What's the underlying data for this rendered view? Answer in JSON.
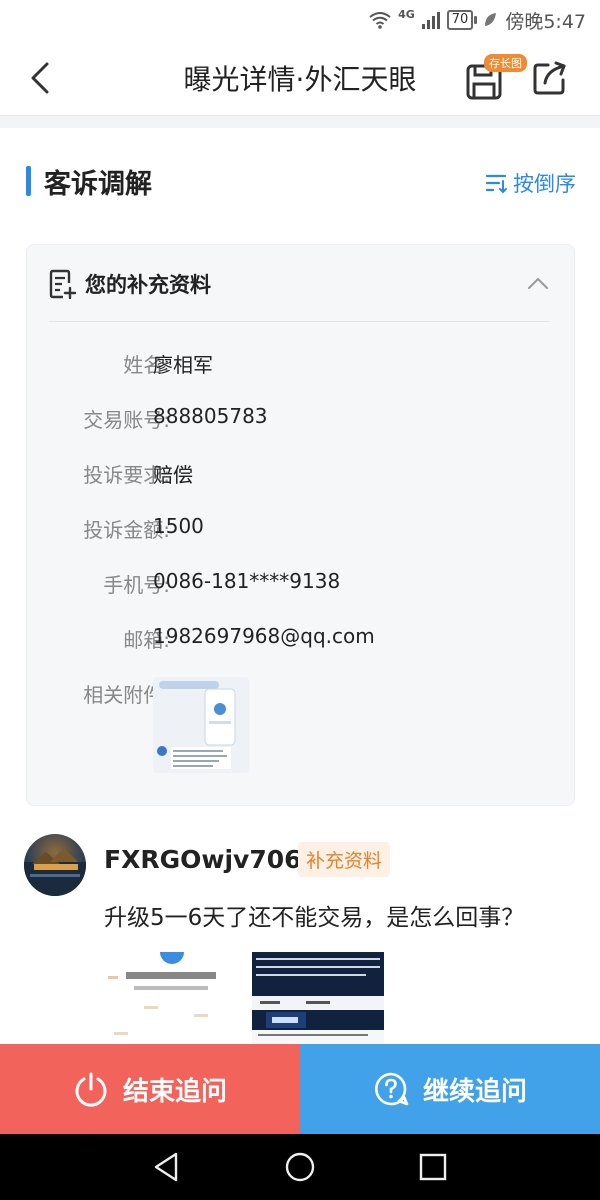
{
  "status_bar": {
    "network": "4G",
    "battery": "70",
    "time": "傍晚5:47"
  },
  "header": {
    "title": "曝光详情·外汇天眼",
    "save_badge": "存长图",
    "back_icon": "back-arrow-icon",
    "save_icon": "save-disk-icon",
    "share_icon": "share-icon"
  },
  "section": {
    "title": "客诉调解",
    "sort_label": "按倒序"
  },
  "card": {
    "title": "您的补充资料",
    "fields": [
      {
        "label": "姓名:",
        "value": "廖相军"
      },
      {
        "label": "交易账号:",
        "value": "888805783"
      },
      {
        "label": "投诉要求:",
        "value": "赔偿"
      },
      {
        "label": "投诉金额:",
        "value": "1500"
      },
      {
        "label": "手机号:",
        "value": "0086-181****9138"
      },
      {
        "label": "邮箱:",
        "value": "1982697968@qq.com"
      },
      {
        "label": "相关附件:",
        "value": ""
      }
    ]
  },
  "post": {
    "username": "FXRGOwjv7069",
    "tag": "补充资料",
    "text": "升级5一6天了还不能交易，是怎么回事？"
  },
  "actions": {
    "end_label": "结束追问",
    "continue_label": "继续追问"
  },
  "colors": {
    "accent_blue": "#2b8ae6",
    "end_red": "#f2635b",
    "continue_blue": "#41a2ea",
    "tag_orange": "#e5822d"
  }
}
